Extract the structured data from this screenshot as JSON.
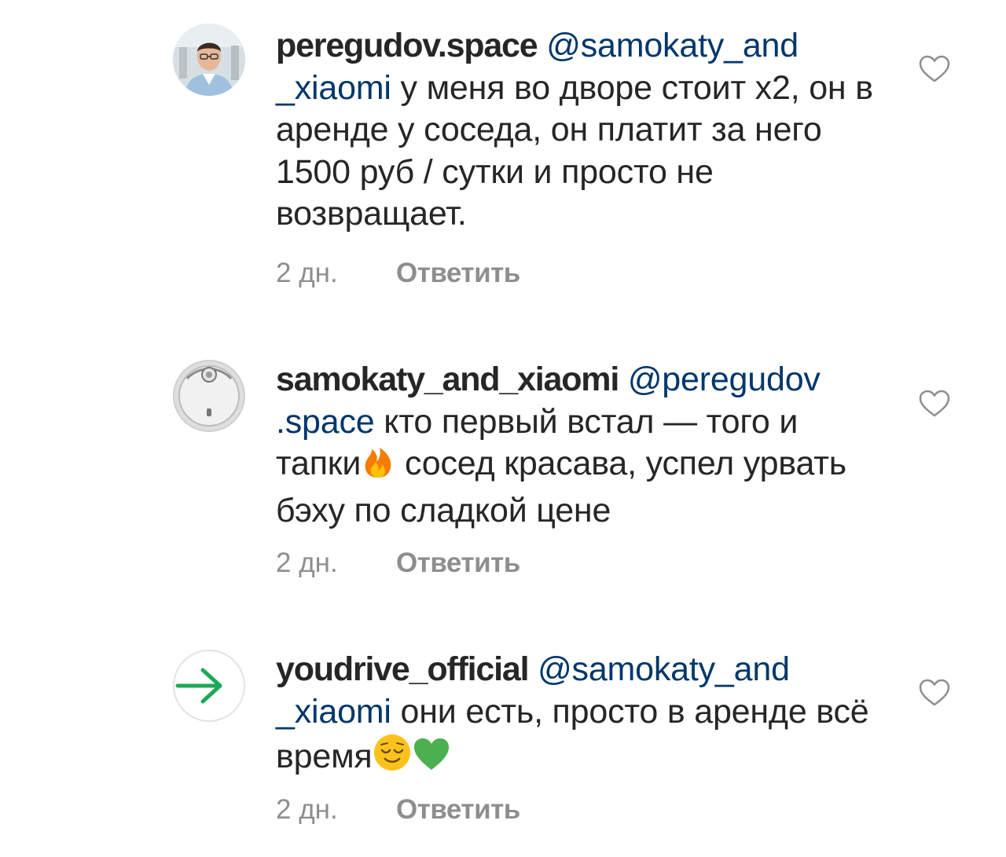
{
  "comments": [
    {
      "username": "peregudov.space",
      "mention_part1": "@samokaty_and",
      "mention_part2": "_xiaomi",
      "body": " у меня во дворе стоит х2, он в аренде у соседа, он платит за него 1500 руб / сутки и просто не возвращает.",
      "time": "2 дн.",
      "reply_label": "Ответить",
      "avatar_icon": "user-photo"
    },
    {
      "username": "samokaty_and_xiaomi",
      "mention_part1": "@peregudov",
      "mention_part2": ".space",
      "body_part1": " кто первый встал — того и тапки",
      "body_part2": " сосед красава, успел урвать бэху по сладкой цене",
      "emoji1": "fire-emoji",
      "time": "2 дн.",
      "reply_label": "Ответить",
      "avatar_icon": "robot-vacuum"
    },
    {
      "username": "youdrive_official",
      "mention_part1": "@samokaty_and",
      "mention_part2": "_xiaomi",
      "body": " они есть, просто в аренде всё время",
      "emoji1": "relieved-face-emoji",
      "emoji2": "green-heart-emoji",
      "time": "2 дн.",
      "reply_label": "Ответить",
      "avatar_icon": "green-arrow-logo",
      "accent_color": "#1fa855"
    }
  ]
}
